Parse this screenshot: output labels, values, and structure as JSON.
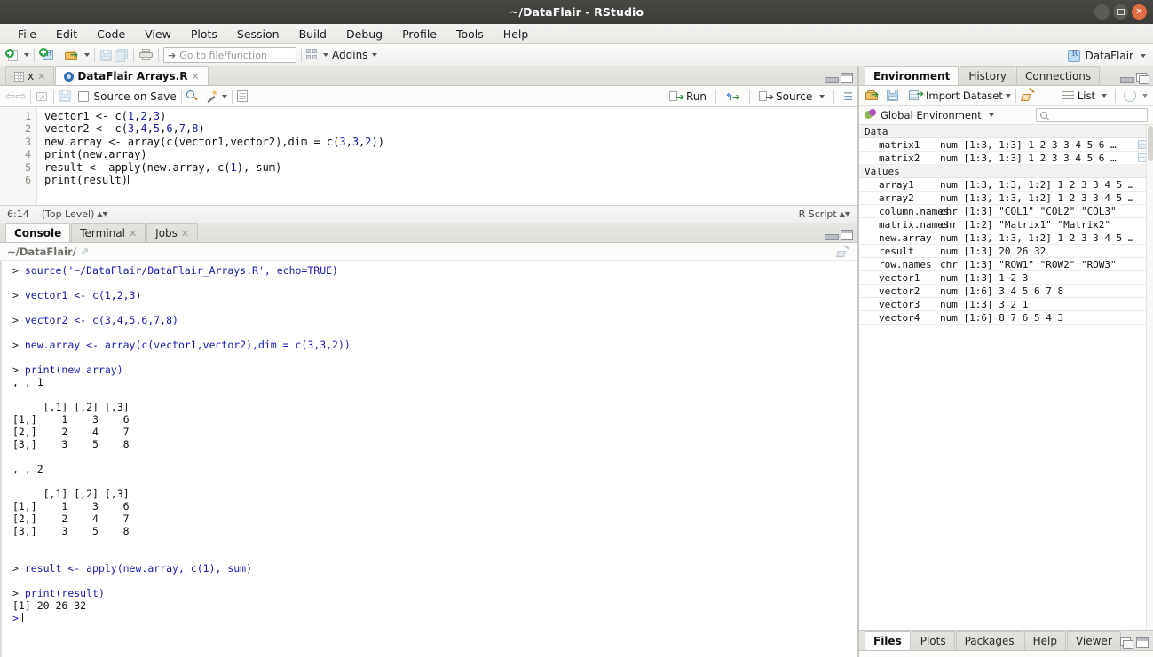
{
  "window": {
    "title": "~/DataFlair - RStudio",
    "controls": {
      "minimize": "minimize-button",
      "maximize": "maximize-button",
      "close": "close-button"
    }
  },
  "menubar": {
    "items": [
      {
        "label": "File"
      },
      {
        "label": "Edit"
      },
      {
        "label": "Code"
      },
      {
        "label": "View"
      },
      {
        "label": "Plots"
      },
      {
        "label": "Session"
      },
      {
        "label": "Build"
      },
      {
        "label": "Debug"
      },
      {
        "label": "Profile"
      },
      {
        "label": "Tools"
      },
      {
        "label": "Help"
      }
    ]
  },
  "toolbar": {
    "goto_placeholder": "Go to file/function",
    "addins_label": "Addins",
    "project_name": "DataFlair"
  },
  "source": {
    "tabs": [
      {
        "label": "x",
        "icon": "sheet-icon",
        "active": false
      },
      {
        "label": "DataFlair  Arrays.R",
        "icon": "r-script-icon",
        "active": true
      }
    ],
    "toolbar": {
      "source_on_save": "Source on Save",
      "run_label": "Run",
      "source_label": "Source"
    },
    "lines": [
      {
        "n": "1",
        "html": "vector1 <- c(<span class=\"num\">1</span>,<span class=\"num\">2</span>,<span class=\"num\">3</span>)"
      },
      {
        "n": "2",
        "html": "vector2 <- c(<span class=\"num\">3</span>,<span class=\"num\">4</span>,<span class=\"num\">5</span>,<span class=\"num\">6</span>,<span class=\"num\">7</span>,<span class=\"num\">8</span>)"
      },
      {
        "n": "3",
        "html": "new.array <- array(c(vector1,vector2),dim = c(<span class=\"num\">3</span>,<span class=\"num\">3</span>,<span class=\"num\">2</span>))"
      },
      {
        "n": "4",
        "html": "print(new.array)"
      },
      {
        "n": "5",
        "html": "result <- apply(new.array, c(<span class=\"num\">1</span>), sum)"
      },
      {
        "n": "6",
        "html": "print(result)<span class=\"cursor-bar\"></span>"
      }
    ],
    "status": {
      "position": "6:14",
      "scope": "(Top Level)",
      "file_type": "R Script"
    }
  },
  "console": {
    "tabs": [
      {
        "label": "Console",
        "active": true,
        "closable": false
      },
      {
        "label": "Terminal",
        "active": false,
        "closable": true
      },
      {
        "label": "Jobs",
        "active": false,
        "closable": true
      }
    ],
    "path": "~/DataFlair/",
    "lines": [
      {
        "html": "<span class=\"prompt\">&gt; </span><span class=\"cmd\">source('~/DataFlair/DataFlair_Arrays.R', echo=TRUE)</span>"
      },
      {
        "html": ""
      },
      {
        "html": "<span class=\"prompt\">&gt; </span><span class=\"cmd\">vector1 &lt;- c(1,2,3)</span>"
      },
      {
        "html": ""
      },
      {
        "html": "<span class=\"prompt\">&gt; </span><span class=\"cmd\">vector2 &lt;- c(3,4,5,6,7,8)</span>"
      },
      {
        "html": ""
      },
      {
        "html": "<span class=\"prompt\">&gt; </span><span class=\"cmd\">new.array &lt;- array(c(vector1,vector2),dim = c(3,3,2))</span>"
      },
      {
        "html": ""
      },
      {
        "html": "<span class=\"prompt\">&gt; </span><span class=\"cmd\">print(new.array)</span>"
      },
      {
        "html": ", , 1"
      },
      {
        "html": ""
      },
      {
        "html": "     [,1] [,2] [,3]"
      },
      {
        "html": "[1,]    1    3    6"
      },
      {
        "html": "[2,]    2    4    7"
      },
      {
        "html": "[3,]    3    5    8"
      },
      {
        "html": ""
      },
      {
        "html": ", , 2"
      },
      {
        "html": ""
      },
      {
        "html": "     [,1] [,2] [,3]"
      },
      {
        "html": "[1,]    1    3    6"
      },
      {
        "html": "[2,]    2    4    7"
      },
      {
        "html": "[3,]    3    5    8"
      },
      {
        "html": ""
      },
      {
        "html": ""
      },
      {
        "html": "<span class=\"prompt\">&gt; </span><span class=\"cmd\">result &lt;- apply(new.array, c(1), sum)</span>"
      },
      {
        "html": ""
      },
      {
        "html": "<span class=\"prompt\">&gt; </span><span class=\"cmd\">print(result)</span>"
      },
      {
        "html": "[1] 20 26 32"
      },
      {
        "html": "<span class=\"cblue\">&gt;</span><span class=\"ccursor\"></span>"
      }
    ]
  },
  "environment": {
    "tabs": [
      {
        "label": "Environment",
        "active": true
      },
      {
        "label": "History",
        "active": false
      },
      {
        "label": "Connections",
        "active": false
      }
    ],
    "toolbar": {
      "import_label": "Import Dataset",
      "view_mode": "List"
    },
    "scope": "Global Environment",
    "search_value": "",
    "groups": [
      {
        "title": "Data",
        "rows": [
          {
            "name": "matrix1",
            "value": "num [1:3, 1:3] 1 2 3 3 4 5 6 …",
            "has_grid": true
          },
          {
            "name": "matrix2",
            "value": "num [1:3, 1:3] 1 2 3 3 4 5 6 …",
            "has_grid": true
          }
        ]
      },
      {
        "title": "Values",
        "rows": [
          {
            "name": "array1",
            "value": "num [1:3, 1:3, 1:2] 1 2 3 3 4 5 …",
            "has_grid": false
          },
          {
            "name": "array2",
            "value": "num [1:3, 1:3, 1:2] 1 2 3 3 4 5 …",
            "has_grid": false
          },
          {
            "name": "column.names",
            "value": "chr [1:3] \"COL1\" \"COL2\" \"COL3\"",
            "has_grid": false
          },
          {
            "name": "matrix.names",
            "value": "chr [1:2] \"Matrix1\" \"Matrix2\"",
            "has_grid": false
          },
          {
            "name": "new.array",
            "value": "num [1:3, 1:3, 1:2] 1 2 3 3 4 5 …",
            "has_grid": false
          },
          {
            "name": "result",
            "value": "num [1:3] 20 26 32",
            "has_grid": false
          },
          {
            "name": "row.names",
            "value": "chr [1:3] \"ROW1\" \"ROW2\" \"ROW3\"",
            "has_grid": false
          },
          {
            "name": "vector1",
            "value": "num [1:3] 1 2 3",
            "has_grid": false
          },
          {
            "name": "vector2",
            "value": "num [1:6] 3 4 5 6 7 8",
            "has_grid": false
          },
          {
            "name": "vector3",
            "value": "num [1:3] 3 2 1",
            "has_grid": false
          },
          {
            "name": "vector4",
            "value": "num [1:6] 8 7 6 5 4 3",
            "has_grid": false
          }
        ]
      }
    ]
  },
  "files_pane": {
    "tabs": [
      {
        "label": "Files",
        "active": true
      },
      {
        "label": "Plots",
        "active": false
      },
      {
        "label": "Packages",
        "active": false
      },
      {
        "label": "Help",
        "active": false
      },
      {
        "label": "Viewer",
        "active": false
      }
    ]
  }
}
